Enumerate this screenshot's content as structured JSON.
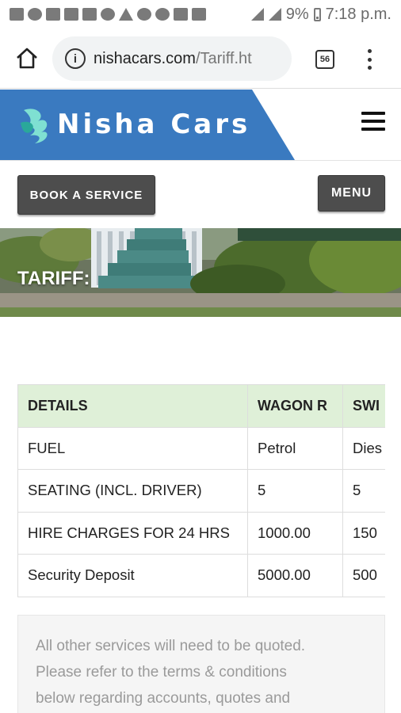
{
  "status_bar": {
    "battery": "9%",
    "time": "7:18 p.m."
  },
  "browser": {
    "url_host": "nishacars.com",
    "url_path": "/Tariff.ht",
    "tab_count": "56"
  },
  "site": {
    "brand": "Nisha Cars",
    "brand_color": "#3a7ac0"
  },
  "buttons": {
    "book": "BOOK A SERVICE",
    "menu": "MENU"
  },
  "hero": {
    "title": "TARIFF:"
  },
  "table": {
    "headers": [
      "DETAILS",
      "WAGON R",
      "SWI"
    ],
    "rows": [
      [
        "FUEL",
        "Petrol",
        "Dies"
      ],
      [
        "SEATING (INCL. DRIVER)",
        "5",
        "5"
      ],
      [
        "HIRE CHARGES FOR 24 HRS",
        "1000.00",
        "150"
      ],
      [
        "Security Deposit",
        "5000.00",
        "500"
      ]
    ]
  },
  "note": {
    "lines": [
      "All other services will need to be quoted.",
      "Please refer to the terms & conditions",
      "below regarding accounts, quotes and"
    ]
  }
}
